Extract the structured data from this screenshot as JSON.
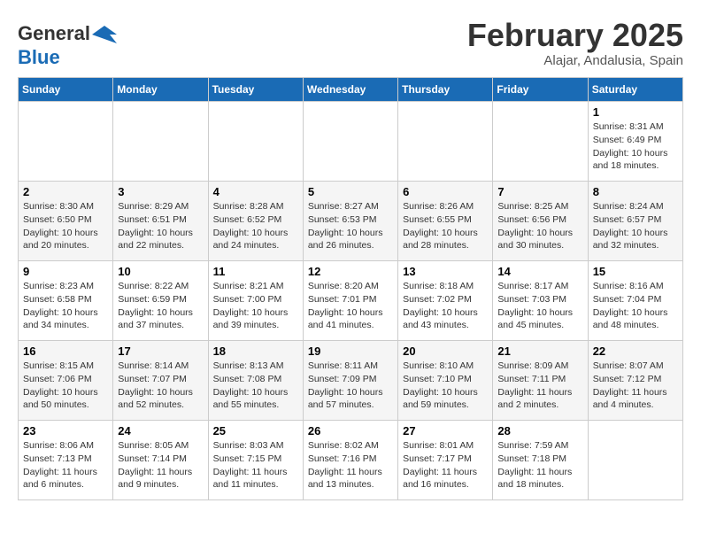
{
  "header": {
    "logo_line1": "General",
    "logo_line2": "Blue",
    "month": "February 2025",
    "location": "Alajar, Andalusia, Spain"
  },
  "weekdays": [
    "Sunday",
    "Monday",
    "Tuesday",
    "Wednesday",
    "Thursday",
    "Friday",
    "Saturday"
  ],
  "weeks": [
    [
      null,
      null,
      null,
      null,
      null,
      null,
      {
        "day": "1",
        "sunrise": "8:31 AM",
        "sunset": "6:49 PM",
        "daylight": "10 hours and 18 minutes."
      }
    ],
    [
      {
        "day": "2",
        "sunrise": "8:30 AM",
        "sunset": "6:50 PM",
        "daylight": "10 hours and 20 minutes."
      },
      {
        "day": "3",
        "sunrise": "8:29 AM",
        "sunset": "6:51 PM",
        "daylight": "10 hours and 22 minutes."
      },
      {
        "day": "4",
        "sunrise": "8:28 AM",
        "sunset": "6:52 PM",
        "daylight": "10 hours and 24 minutes."
      },
      {
        "day": "5",
        "sunrise": "8:27 AM",
        "sunset": "6:53 PM",
        "daylight": "10 hours and 26 minutes."
      },
      {
        "day": "6",
        "sunrise": "8:26 AM",
        "sunset": "6:55 PM",
        "daylight": "10 hours and 28 minutes."
      },
      {
        "day": "7",
        "sunrise": "8:25 AM",
        "sunset": "6:56 PM",
        "daylight": "10 hours and 30 minutes."
      },
      {
        "day": "8",
        "sunrise": "8:24 AM",
        "sunset": "6:57 PM",
        "daylight": "10 hours and 32 minutes."
      }
    ],
    [
      {
        "day": "9",
        "sunrise": "8:23 AM",
        "sunset": "6:58 PM",
        "daylight": "10 hours and 34 minutes."
      },
      {
        "day": "10",
        "sunrise": "8:22 AM",
        "sunset": "6:59 PM",
        "daylight": "10 hours and 37 minutes."
      },
      {
        "day": "11",
        "sunrise": "8:21 AM",
        "sunset": "7:00 PM",
        "daylight": "10 hours and 39 minutes."
      },
      {
        "day": "12",
        "sunrise": "8:20 AM",
        "sunset": "7:01 PM",
        "daylight": "10 hours and 41 minutes."
      },
      {
        "day": "13",
        "sunrise": "8:18 AM",
        "sunset": "7:02 PM",
        "daylight": "10 hours and 43 minutes."
      },
      {
        "day": "14",
        "sunrise": "8:17 AM",
        "sunset": "7:03 PM",
        "daylight": "10 hours and 45 minutes."
      },
      {
        "day": "15",
        "sunrise": "8:16 AM",
        "sunset": "7:04 PM",
        "daylight": "10 hours and 48 minutes."
      }
    ],
    [
      {
        "day": "16",
        "sunrise": "8:15 AM",
        "sunset": "7:06 PM",
        "daylight": "10 hours and 50 minutes."
      },
      {
        "day": "17",
        "sunrise": "8:14 AM",
        "sunset": "7:07 PM",
        "daylight": "10 hours and 52 minutes."
      },
      {
        "day": "18",
        "sunrise": "8:13 AM",
        "sunset": "7:08 PM",
        "daylight": "10 hours and 55 minutes."
      },
      {
        "day": "19",
        "sunrise": "8:11 AM",
        "sunset": "7:09 PM",
        "daylight": "10 hours and 57 minutes."
      },
      {
        "day": "20",
        "sunrise": "8:10 AM",
        "sunset": "7:10 PM",
        "daylight": "10 hours and 59 minutes."
      },
      {
        "day": "21",
        "sunrise": "8:09 AM",
        "sunset": "7:11 PM",
        "daylight": "11 hours and 2 minutes."
      },
      {
        "day": "22",
        "sunrise": "8:07 AM",
        "sunset": "7:12 PM",
        "daylight": "11 hours and 4 minutes."
      }
    ],
    [
      {
        "day": "23",
        "sunrise": "8:06 AM",
        "sunset": "7:13 PM",
        "daylight": "11 hours and 6 minutes."
      },
      {
        "day": "24",
        "sunrise": "8:05 AM",
        "sunset": "7:14 PM",
        "daylight": "11 hours and 9 minutes."
      },
      {
        "day": "25",
        "sunrise": "8:03 AM",
        "sunset": "7:15 PM",
        "daylight": "11 hours and 11 minutes."
      },
      {
        "day": "26",
        "sunrise": "8:02 AM",
        "sunset": "7:16 PM",
        "daylight": "11 hours and 13 minutes."
      },
      {
        "day": "27",
        "sunrise": "8:01 AM",
        "sunset": "7:17 PM",
        "daylight": "11 hours and 16 minutes."
      },
      {
        "day": "28",
        "sunrise": "7:59 AM",
        "sunset": "7:18 PM",
        "daylight": "11 hours and 18 minutes."
      },
      null
    ]
  ]
}
